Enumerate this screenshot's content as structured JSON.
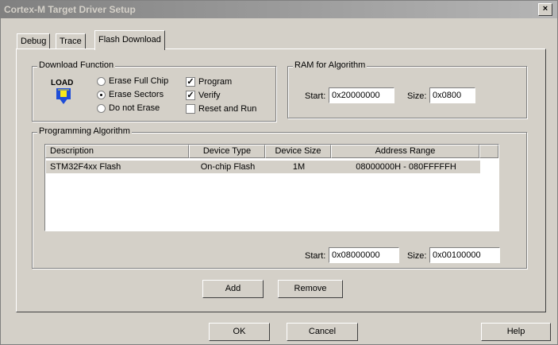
{
  "window": {
    "title": "Cortex-M Target Driver Setup",
    "close_glyph": "×"
  },
  "tabs": [
    {
      "label": "Debug"
    },
    {
      "label": "Trace"
    },
    {
      "label": "Flash Download",
      "active": true
    }
  ],
  "download_function": {
    "group_label": "Download Function",
    "icon_text": "LOAD",
    "radios": [
      {
        "label": "Erase Full Chip",
        "checked": false
      },
      {
        "label": "Erase Sectors",
        "checked": true
      },
      {
        "label": "Do not Erase",
        "checked": false
      }
    ],
    "checks": [
      {
        "label": "Program",
        "checked": true
      },
      {
        "label": "Verify",
        "checked": true
      },
      {
        "label": "Reset and Run",
        "checked": false
      }
    ]
  },
  "ram_for_algorithm": {
    "group_label": "RAM for Algorithm",
    "start_label": "Start:",
    "start_value": "0x20000000",
    "size_label": "Size:",
    "size_value": "0x0800"
  },
  "programming_algorithm": {
    "group_label": "Programming Algorithm",
    "columns": [
      "Description",
      "Device Type",
      "Device Size",
      "Address Range"
    ],
    "rows": [
      [
        "STM32F4xx Flash",
        "On-chip Flash",
        "1M",
        "08000000H - 080FFFFFH"
      ]
    ],
    "start_label": "Start:",
    "start_value": "0x08000000",
    "size_label": "Size:",
    "size_value": "0x00100000"
  },
  "buttons": {
    "add": "Add",
    "remove": "Remove",
    "ok": "OK",
    "cancel": "Cancel",
    "help": "Help"
  },
  "colors": {
    "titlebar": "#808080",
    "dialog_bg": "#d4d0c8",
    "selected_row": "#d4d0c8"
  }
}
